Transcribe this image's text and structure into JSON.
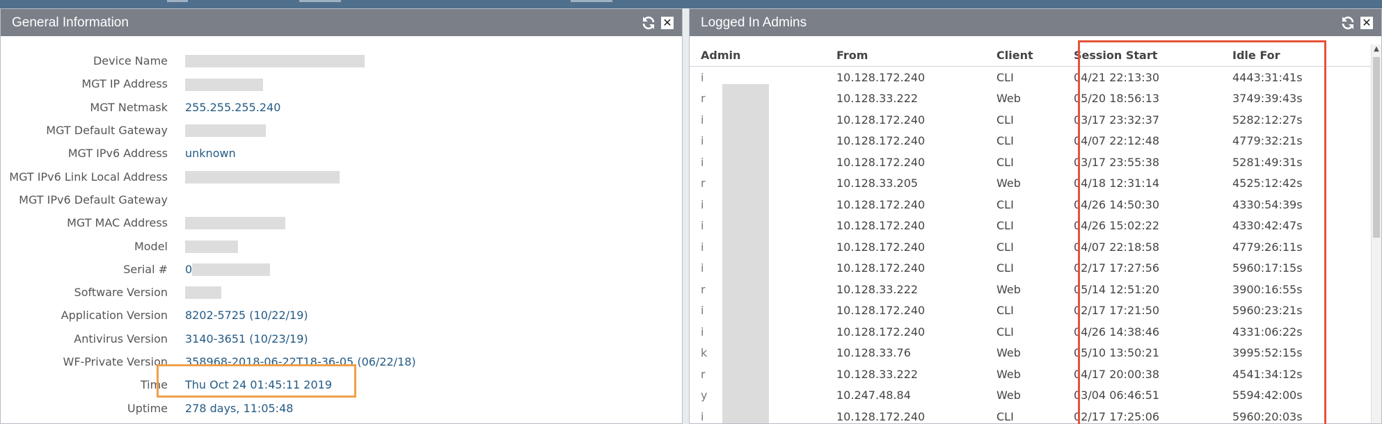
{
  "general": {
    "title": "General Information",
    "rows": [
      {
        "label": "Device Name",
        "value": ""
      },
      {
        "label": "MGT IP Address",
        "value": ""
      },
      {
        "label": "MGT Netmask",
        "value": "255.255.255.240"
      },
      {
        "label": "MGT Default Gateway",
        "value": ""
      },
      {
        "label": "MGT IPv6 Address",
        "value": "unknown"
      },
      {
        "label": "MGT IPv6 Link Local Address",
        "value": ""
      },
      {
        "label": "MGT IPv6 Default Gateway",
        "value": ""
      },
      {
        "label": "MGT MAC Address",
        "value": ""
      },
      {
        "label": "Model",
        "value": ""
      },
      {
        "label": "Serial #",
        "value": "0"
      },
      {
        "label": "Software Version",
        "value": ""
      },
      {
        "label": "Application Version",
        "value": "8202-5725 (10/22/19)"
      },
      {
        "label": "Antivirus Version",
        "value": "3140-3651 (10/23/19)"
      },
      {
        "label": "WF-Private Version",
        "value": "358968-2018-06-22T18-36-05 (06/22/18)"
      },
      {
        "label": "Time",
        "value": "Thu Oct 24 01:45:11 2019"
      },
      {
        "label": "Uptime",
        "value": "278 days, 11:05:48"
      }
    ]
  },
  "admins": {
    "title": "Logged In Admins",
    "columns": [
      "Admin",
      "From",
      "Client",
      "Session Start",
      "Idle For"
    ],
    "rows": [
      {
        "admin": "i",
        "from": "10.128.172.240",
        "client": "CLI",
        "start": "04/21 22:13:30",
        "idle": "4443:31:41s"
      },
      {
        "admin": "r",
        "from": "10.128.33.222",
        "client": "Web",
        "start": "05/20 18:56:13",
        "idle": "3749:39:43s"
      },
      {
        "admin": "i",
        "from": "10.128.172.240",
        "client": "CLI",
        "start": "03/17 23:32:37",
        "idle": "5282:12:27s"
      },
      {
        "admin": "i",
        "from": "10.128.172.240",
        "client": "CLI",
        "start": "04/07 22:12:48",
        "idle": "4779:32:21s"
      },
      {
        "admin": "i",
        "from": "10.128.172.240",
        "client": "CLI",
        "start": "03/17 23:55:38",
        "idle": "5281:49:31s"
      },
      {
        "admin": "r",
        "from": "10.128.33.205",
        "client": "Web",
        "start": "04/18 12:31:14",
        "idle": "4525:12:42s"
      },
      {
        "admin": "i",
        "from": "10.128.172.240",
        "client": "CLI",
        "start": "04/26 14:50:30",
        "idle": "4330:54:39s"
      },
      {
        "admin": "i",
        "from": "10.128.172.240",
        "client": "CLI",
        "start": "04/26 15:02:22",
        "idle": "4330:42:47s"
      },
      {
        "admin": "i",
        "from": "10.128.172.240",
        "client": "CLI",
        "start": "04/07 22:18:58",
        "idle": "4779:26:11s"
      },
      {
        "admin": "i",
        "from": "10.128.172.240",
        "client": "CLI",
        "start": "02/17 17:27:56",
        "idle": "5960:17:15s"
      },
      {
        "admin": "r",
        "from": "10.128.33.222",
        "client": "Web",
        "start": "05/14 12:51:20",
        "idle": "3900:16:55s"
      },
      {
        "admin": "i",
        "from": "10.128.172.240",
        "client": "CLI",
        "start": "02/17 17:21:50",
        "idle": "5960:23:21s"
      },
      {
        "admin": "i",
        "from": "10.128.172.240",
        "client": "CLI",
        "start": "04/26 14:38:46",
        "idle": "4331:06:22s"
      },
      {
        "admin": "k",
        "from": "10.128.33.76",
        "client": "Web",
        "start": "05/10 13:50:21",
        "idle": "3995:52:15s"
      },
      {
        "admin": "r",
        "from": "10.128.33.222",
        "client": "Web",
        "start": "04/17 20:00:38",
        "idle": "4541:34:12s"
      },
      {
        "admin": "y",
        "from": "10.247.48.84",
        "client": "Web",
        "start": "03/04 06:46:51",
        "idle": "5594:42:00s"
      },
      {
        "admin": "i",
        "from": "10.128.172.240",
        "client": "CLI",
        "start": "02/17 17:25:06",
        "idle": "5960:20:03s"
      }
    ]
  },
  "colors": {
    "header_bg": "#7a7f88",
    "value_text": "#245b85",
    "highlight_time": "#f0a04b",
    "highlight_sessions": "#e5533a"
  },
  "icons": [
    "refresh-icon",
    "close-icon"
  ]
}
